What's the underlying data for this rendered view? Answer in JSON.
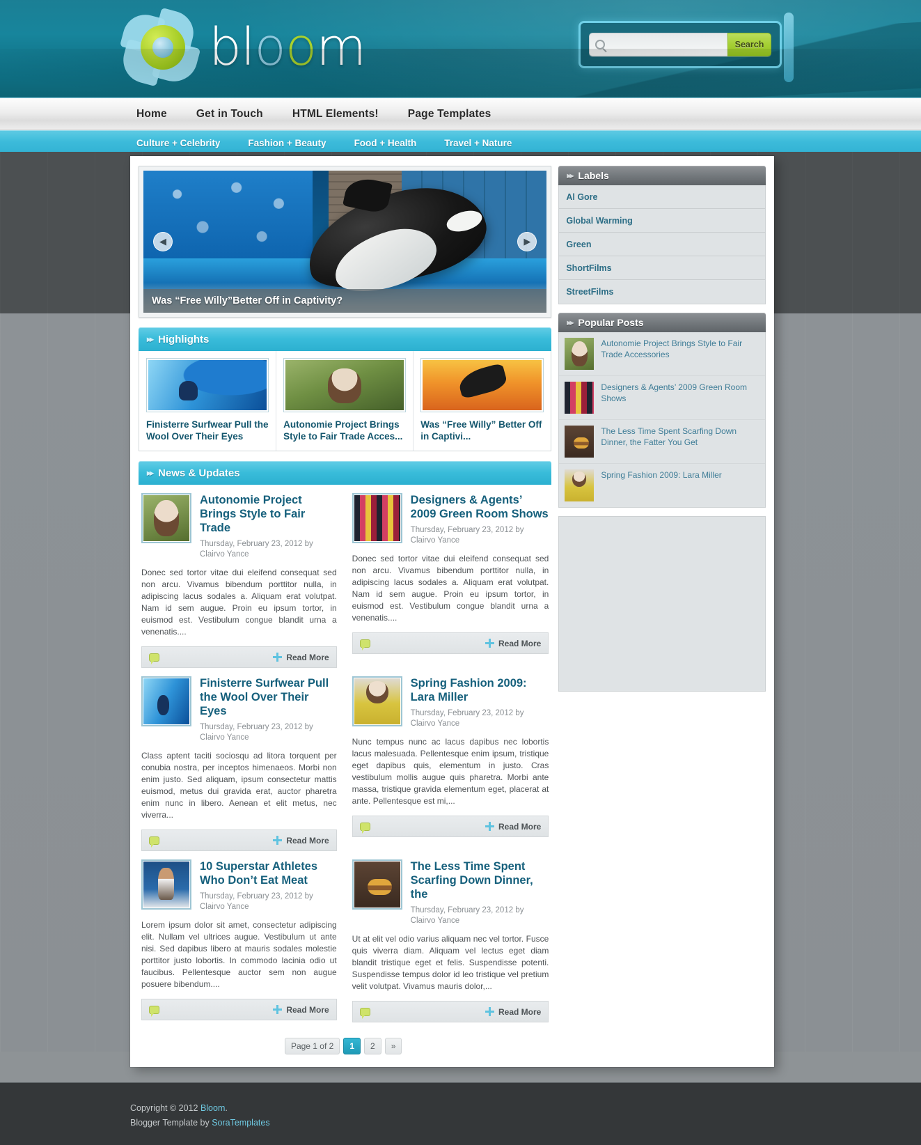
{
  "site": {
    "logo_text_a": "bl",
    "logo_text_o1": "o",
    "logo_text_o2": "o",
    "logo_text_b": "m",
    "logo_alt": "bloom"
  },
  "search": {
    "value": "",
    "placeholder": "",
    "button_label": "Search",
    "icon": "search-icon"
  },
  "nav_main": [
    {
      "label": "Home"
    },
    {
      "label": "Get in Touch"
    },
    {
      "label": "HTML Elements!"
    },
    {
      "label": "Page Templates"
    }
  ],
  "nav_sub": [
    {
      "label": "Culture + Celebrity"
    },
    {
      "label": "Fashion + Beauty"
    },
    {
      "label": "Food + Health"
    },
    {
      "label": "Travel + Nature"
    }
  ],
  "slider": {
    "caption": "Was “Free Willy”Better Off in Captivity?",
    "prev_icon": "chevron-left-icon",
    "next_icon": "chevron-right-icon"
  },
  "highlights": {
    "title": "Highlights",
    "items": [
      {
        "title": "Finisterre Surfwear Pull the Wool Over Their Eyes",
        "thumb": "surfer-image"
      },
      {
        "title": "Autonomie Project Brings Style to Fair Trade Acces...",
        "thumb": "girl-in-hat-image"
      },
      {
        "title": "Was “Free Willy” Better Off in Captivi...",
        "thumb": "orca-sunset-image"
      }
    ]
  },
  "news": {
    "title": "News & Updates",
    "readmore_label": "Read More",
    "posts": [
      {
        "title": "Autonomie Project Brings Style to Fair Trade",
        "meta": "Thursday, February 23, 2012 by Clairvo Yance",
        "body": "Donec sed tortor vitae dui eleifend consequat sed non arcu. Vivamus bibendum porttitor nulla, in adipiscing lacus sodales a. Aliquam erat volutpat. Nam id sem augue. Proin eu ipsum tortor, in euismod est. Vestibulum congue blandit urna a venenatis....",
        "thumb": "girl-in-hat-image"
      },
      {
        "title": "Designers & Agents’ 2009 Green Room Shows",
        "meta": "Thursday, February 23, 2012 by Clairvo Yance",
        "body": "Donec sed tortor vitae dui eleifend consequat sed non arcu. Vivamus bibendum porttitor nulla, in adipiscing lacus sodales a. Aliquam erat volutpat. Nam id sem augue. Proin eu ipsum tortor, in euismod est. Vestibulum congue blandit urna a venenatis....",
        "thumb": "clothes-rack-image"
      },
      {
        "title": "Finisterre Surfwear Pull the Wool Over Their Eyes",
        "meta": "Thursday, February 23, 2012 by Clairvo Yance",
        "body": "Class aptent taciti sociosqu ad litora torquent per conubia nostra, per inceptos himenaeos. Morbi non enim justo. Sed aliquam, ipsum consectetur mattis euismod, metus dui gravida erat, auctor pharetra enim nunc in libero. Aenean et elit metus, nec viverra...",
        "thumb": "surfer-image"
      },
      {
        "title": "Spring Fashion 2009: Lara Miller",
        "meta": "Thursday, February 23, 2012 by Clairvo Yance",
        "body": "Nunc tempus nunc ac lacus dapibus nec lobortis lacus malesuada. Pellentesque enim ipsum, tristique eget dapibus quis, elementum in justo. Cras vestibulum mollis augue quis pharetra. Morbi ante massa, tristique gravida elementum eget, placerat at ante. Pellentesque est mi,...",
        "thumb": "lara-miller-image"
      },
      {
        "title": "10 Superstar Athletes Who Don’t Eat Meat",
        "meta": "Thursday, February 23, 2012 by Clairvo Yance",
        "body": "Lorem ipsum dolor sit amet, consectetur adipiscing elit. Nullam vel ultrices augue. Vestibulum ut ante nisi. Sed dapibus libero at mauris sodales molestie porttitor justo lobortis. In commodo lacinia odio ut faucibus. Pellentesque auctor sem non augue posuere bibendum....",
        "thumb": "athlete-image"
      },
      {
        "title": "The Less Time Spent Scarfing Down Dinner, the",
        "meta": "Thursday, February 23, 2012 by Clairvo Yance",
        "body": "Ut at elit vel odio varius aliquam nec vel tortor. Fusce quis viverra diam. Aliquam vel lectus eget diam blandit tristique eget et felis. Suspendisse potenti. Suspendisse tempus dolor id leo tristique vel pretium velit volutpat. Vivamus mauris dolor,...",
        "thumb": "burger-eater-image"
      }
    ]
  },
  "pagination": {
    "status": "Page 1 of 2",
    "pages": [
      "1",
      "2"
    ],
    "next_label": "»",
    "active": "1"
  },
  "sidebar": {
    "labels_widget": {
      "title": "Labels",
      "items": [
        {
          "label": "Al Gore"
        },
        {
          "label": "Global Warming"
        },
        {
          "label": "Green"
        },
        {
          "label": "ShortFilms"
        },
        {
          "label": "StreetFilms"
        }
      ]
    },
    "popular_widget": {
      "title": "Popular Posts",
      "items": [
        {
          "title": "Autonomie Project Brings Style to Fair Trade Accessories",
          "thumb": "girl-in-hat-image"
        },
        {
          "title": "Designers & Agents’ 2009 Green Room Shows",
          "thumb": "clothes-rack-image"
        },
        {
          "title": "The Less Time Spent Scarfing Down Dinner, the Fatter You Get",
          "thumb": "burger-eater-image"
        },
        {
          "title": "Spring Fashion 2009: Lara Miller",
          "thumb": "lara-miller-image"
        }
      ]
    }
  },
  "footer": {
    "copyright_prefix": "Copyright © 2012 ",
    "copyright_link": "Bloom",
    "copyright_suffix": ".",
    "credit_prefix": "Blogger Template by ",
    "credit_link": "SoraTemplates"
  },
  "colors": {
    "brand_teal": "#2cb0d0",
    "header_teal": "#17859c",
    "accent_green": "#a5cf34",
    "link_blue": "#16607c"
  }
}
